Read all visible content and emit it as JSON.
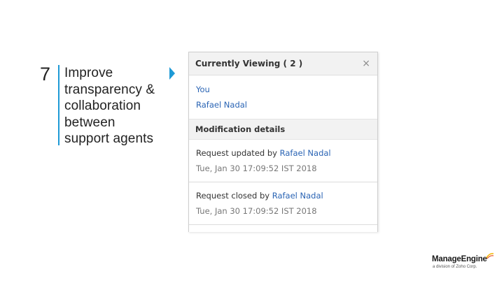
{
  "slide": {
    "number": "7",
    "headline": "Improve\ntransparency &\ncollaboration\nbetween\nsupport agents",
    "accent_color": "#1e9ad6"
  },
  "panel": {
    "title": "Currently Viewing ( 2 )",
    "close_symbol": "×",
    "viewers": [
      "You",
      "Rafael Nadal"
    ],
    "section_title": "Modification details",
    "history": [
      {
        "action": "Request updated by",
        "user": "Rafael Nadal",
        "timestamp": "Tue, Jan 30 17:09:52 IST 2018"
      },
      {
        "action": "Request closed by",
        "user": "Rafael Nadal",
        "timestamp": "Tue, Jan 30 17:09:52 IST 2018"
      }
    ],
    "link_color": "#2a64b4"
  },
  "brand": {
    "name": "ManageEngine",
    "tagline": "a division of Zoho Corp."
  }
}
